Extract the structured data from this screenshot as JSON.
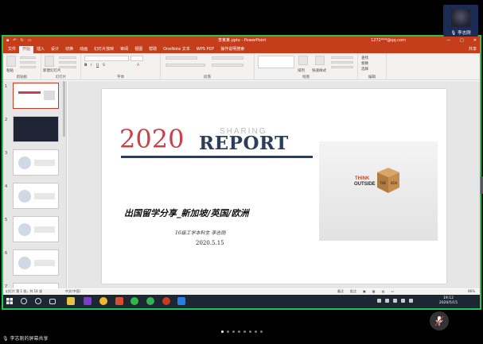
{
  "meeting": {
    "participant_name": "李志刚",
    "screen_share_label": "李志刚的屏幕共享",
    "page_dots": 8,
    "active_dot": 0
  },
  "ppt": {
    "title": "李某某.pptx - PowerPoint",
    "user": "1272***@qq.com",
    "share_label": "共享",
    "tabs": [
      "文件",
      "开始",
      "插入",
      "设计",
      "切换",
      "动画",
      "幻灯片放映",
      "审阅",
      "视图",
      "帮助",
      "OneNote 文本",
      "WPS PDF",
      "操作说明搜索"
    ],
    "active_tab": 1,
    "ribbon_groups": [
      "剪贴板",
      "幻灯片",
      "字体",
      "段落",
      "绘图",
      "编辑"
    ],
    "ribbon_buttons": {
      "paste": "粘贴",
      "new_slide": "新建幻灯片",
      "shape": "形状",
      "arrange": "排列",
      "quick_style": "快速样式",
      "find": "查找",
      "replace": "替换",
      "select": "选择"
    },
    "slide_count": 7,
    "selected_slide": 1,
    "status": {
      "slide_info": "幻灯片 第 1 张，共 14 张",
      "language": "中文(中国)",
      "notes": "备注",
      "comments": "批注",
      "zoom": "86%"
    }
  },
  "slide": {
    "year": "2020",
    "sharing": "SHARING",
    "report": "REPORT",
    "main_title": "出国留学分享_新加坡/英国/欧洲",
    "author": "16级工学本科生 李志刚",
    "date": "2020.5.15",
    "photo_text_think": "THINK",
    "photo_text_outside": "OUTSIDE",
    "photo_text_the": "THE",
    "photo_text_box": "BOX"
  },
  "taskbar": {
    "time": "19:12",
    "date": "2020/5/15"
  },
  "colors": {
    "ppt_red": "#c43e1c",
    "share_border": "#1ec84a",
    "year_red": "#c9414a",
    "report_navy": "#2c3e5a"
  }
}
